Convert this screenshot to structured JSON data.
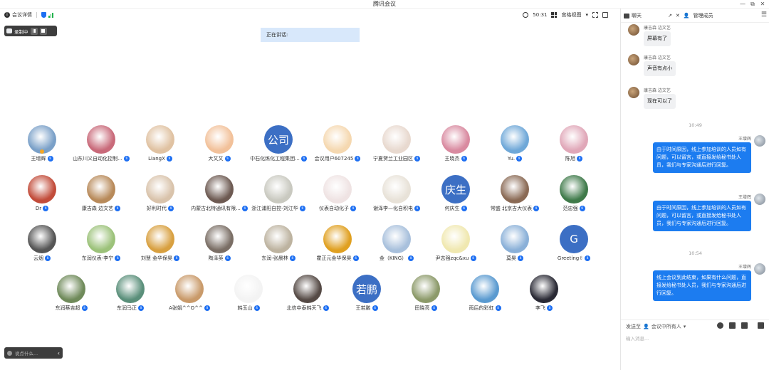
{
  "window": {
    "title": "腾讯会议",
    "min": "—",
    "max": "⧉",
    "close": "✕"
  },
  "toolbar": {
    "info_label": "会议详情",
    "timer": "50:31",
    "view_label": "宫格视图"
  },
  "recording": {
    "label": "录制中"
  },
  "speaking": {
    "label": "正在讲话:"
  },
  "bottom_bar": {
    "placeholder": "说点什么..."
  },
  "participants": [
    [
      {
        "name": "王增辉",
        "avatar": "photo",
        "color": "#7aa0c8",
        "host": true
      },
      {
        "name": "山东川义自动化控制...",
        "avatar": "photo",
        "color": "#c96a7a"
      },
      {
        "name": "LiangX",
        "avatar": "photo",
        "color": "#e0c2a2"
      },
      {
        "name": "大又又",
        "avatar": "photo",
        "color": "#f2c19a"
      },
      {
        "name": "中石化炼化工程集团...",
        "avatar": "text",
        "text": "公司",
        "color": "#3c6fc4"
      },
      {
        "name": "会议用户607245",
        "avatar": "photo",
        "color": "#f5d8b0"
      },
      {
        "name": "宁夏贺兰工业园区",
        "avatar": "photo",
        "color": "#e8d9cf"
      },
      {
        "name": "王晓杰",
        "avatar": "photo",
        "color": "#d98aa0"
      },
      {
        "name": "Yu.",
        "avatar": "photo",
        "color": "#6fa8d8"
      },
      {
        "name": "陈旭",
        "avatar": "photo",
        "color": "#e0a7b8"
      }
    ],
    [
      {
        "name": "Dr",
        "avatar": "photo",
        "color": "#c24c3a"
      },
      {
        "name": "康吉森 边文艺",
        "avatar": "photo",
        "color": "#b88a5a"
      },
      {
        "name": "好利时代",
        "avatar": "photo",
        "color": "#d9c3ab"
      },
      {
        "name": "内蒙古北特通讯有限...",
        "avatar": "photo",
        "color": "#6d5a52"
      },
      {
        "name": "浙江浦阳自控-刘江华",
        "avatar": "photo",
        "color": "#c9c9c0"
      },
      {
        "name": "仪表自动化子",
        "avatar": "photo",
        "color": "#efe3e3"
      },
      {
        "name": "谢泽李—化自积电",
        "avatar": "photo",
        "color": "#e8e2d8"
      },
      {
        "name": "何庆生",
        "avatar": "text",
        "text": "庆生",
        "color": "#3c6fc4"
      },
      {
        "name": "常盛 北京吉大仪表",
        "avatar": "photo",
        "color": "#8a6a55"
      },
      {
        "name": "范忠强",
        "avatar": "photo",
        "color": "#3f7a4a"
      }
    ],
    [
      {
        "name": "云烟",
        "avatar": "photo",
        "color": "#555"
      },
      {
        "name": "东润仪表-李宁",
        "avatar": "photo",
        "color": "#9cc27a"
      },
      {
        "name": "刘慧 金华保昊",
        "avatar": "photo",
        "color": "#d8a040"
      },
      {
        "name": "陶泽英",
        "avatar": "photo",
        "color": "#7a6e65"
      },
      {
        "name": "东润-张晨林",
        "avatar": "photo",
        "color": "#bdb3a0"
      },
      {
        "name": "霍正元金华保昊",
        "avatar": "photo",
        "color": "#e0a020"
      },
      {
        "name": "金（KING）",
        "avatar": "photo",
        "color": "#a8c0dc"
      },
      {
        "name": "尹志强zqc&xu",
        "avatar": "photo",
        "color": "#f0e8b0"
      },
      {
        "name": "莫昊",
        "avatar": "photo",
        "color": "#8ab0d8"
      },
      {
        "name": "Greeting✌",
        "avatar": "text",
        "text": "G",
        "color": "#3c6fc4"
      }
    ],
    [
      {
        "name": "东润蔡吉超",
        "avatar": "photo",
        "color": "#6f8a5a"
      },
      {
        "name": "东润马正",
        "avatar": "photo",
        "color": "#5a8f7a"
      },
      {
        "name": "A张娟^^O^^",
        "avatar": "photo",
        "color": "#c99a6a"
      },
      {
        "name": "韩玉山",
        "avatar": "photo",
        "color": "#f3f3f3"
      },
      {
        "name": "北信中泰韩天飞",
        "avatar": "photo",
        "color": "#554a45"
      },
      {
        "name": "王若鹏",
        "avatar": "text",
        "text": "若鹏",
        "color": "#3c6fc4"
      },
      {
        "name": "田晓亮",
        "avatar": "photo",
        "color": "#8c9a6a"
      },
      {
        "name": "雨后的彩虹",
        "avatar": "photo",
        "color": "#5a9ad0"
      },
      {
        "name": "李飞",
        "avatar": "photo",
        "color": "#2a2a35"
      }
    ]
  ],
  "chat": {
    "title": "聊天",
    "manage": "管理成员",
    "messages": [
      {
        "dir": "in",
        "sender": "康吉森 边文艺",
        "text": "屏幕有了"
      },
      {
        "dir": "in",
        "sender": "康吉森 边文艺",
        "text": "声音有点小"
      },
      {
        "dir": "in",
        "sender": "康吉森 边文艺",
        "text": "现在可以了"
      },
      {
        "dir": "time",
        "text": "10:49"
      },
      {
        "dir": "out",
        "sender": "王增辉",
        "text": "由于时间原因，线上参加培训的人员如有问题，可以留言，或直接发给秘书处人员，我们与专家沟通后进行回复。"
      },
      {
        "dir": "out",
        "sender": "王增辉",
        "text": "由于时间原因，线上参加培训的人员如有问题，可以留言，或直接发给秘书处人员，我们与专家沟通后进行回复。"
      },
      {
        "dir": "time",
        "text": "10:54"
      },
      {
        "dir": "out",
        "sender": "王增辉",
        "text": "线上会议到此结束，如果有什么问题，直接发给秘书处人员，我们与专家沟通后进行回复。"
      }
    ],
    "send_to_label": "发送至",
    "send_to_value": "会议中所有人",
    "input_placeholder": "输入消息..."
  }
}
